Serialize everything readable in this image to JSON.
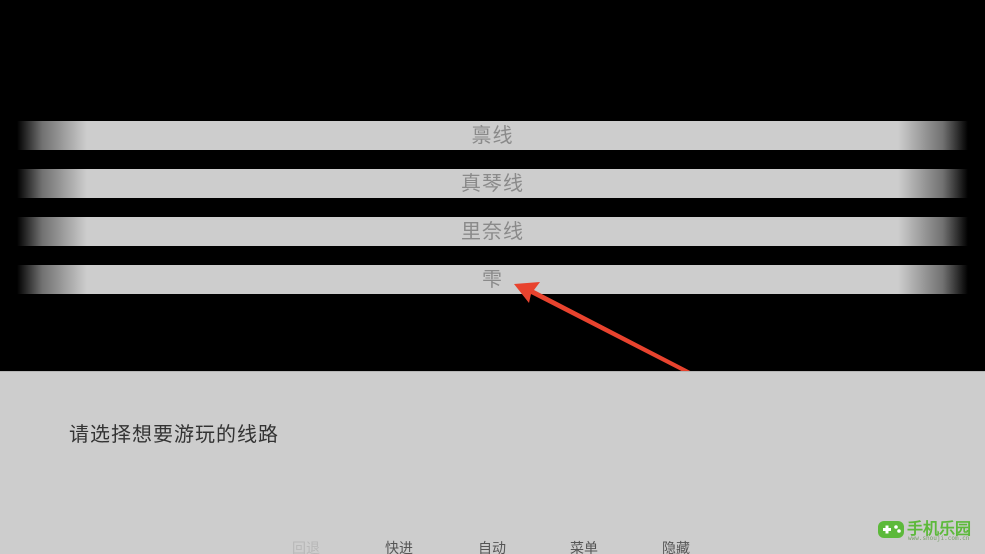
{
  "routes": [
    {
      "label": "禀线"
    },
    {
      "label": "真琴线"
    },
    {
      "label": "里奈线"
    },
    {
      "label": "雫"
    }
  ],
  "dialog": {
    "message": "请选择想要游玩的线路"
  },
  "controls": {
    "back": "回退",
    "fast_forward": "快进",
    "auto": "自动",
    "menu": "菜单",
    "hide": "隐藏"
  },
  "watermark": {
    "name": "手机乐园",
    "url": "www.shouji.com.cn"
  },
  "colors": {
    "option_bar": "#cdcdcd",
    "option_text": "#8a8a8a",
    "textbox_bg": "#cdcdcd",
    "annotation_arrow": "#e8432e",
    "watermark": "#5cb93a"
  }
}
